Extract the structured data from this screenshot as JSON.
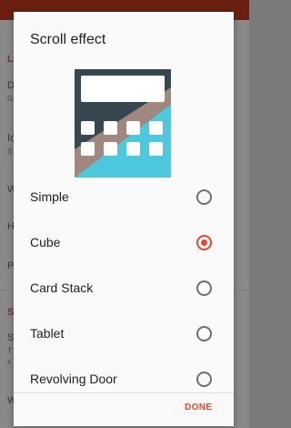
{
  "background": {
    "items": [
      {
        "text": "L",
        "kind": "accent"
      },
      {
        "text": "D",
        "kind": "title"
      },
      {
        "text": "G",
        "kind": "sub"
      },
      {
        "text": "Ic",
        "kind": "title"
      },
      {
        "text": "S",
        "kind": "sub"
      },
      {
        "text": "W",
        "kind": "title"
      },
      {
        "text": "H",
        "kind": "title"
      },
      {
        "text": "P",
        "kind": "title"
      },
      {
        "text": "S",
        "kind": "accent"
      },
      {
        "text": "S",
        "kind": "title"
      },
      {
        "text": "T",
        "kind": "sub"
      },
      {
        "text": "s",
        "kind": "sub"
      },
      {
        "text": "W",
        "kind": "title"
      }
    ]
  },
  "dialog": {
    "title": "Scroll effect",
    "options": [
      {
        "label": "Simple",
        "selected": false
      },
      {
        "label": "Cube",
        "selected": true
      },
      {
        "label": "Card Stack",
        "selected": false
      },
      {
        "label": "Tablet",
        "selected": false
      },
      {
        "label": "Revolving Door",
        "selected": false
      }
    ],
    "done_label": "DONE"
  },
  "colors": {
    "accent": "#e04a2f",
    "preview_dark": "#37474f",
    "preview_tan": "#a1887f",
    "preview_teal": "#4dc8dc"
  },
  "icons": {
    "preview": "app-drawer-preview-icon"
  }
}
